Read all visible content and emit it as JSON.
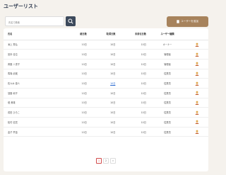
{
  "header": {
    "title": "ユーザーリスト"
  },
  "search": {
    "placeholder": "氏名で検索"
  },
  "toolbar": {
    "add_label": "ユーザーを追加",
    "add_icon": "document-icon",
    "search_icon": "search-icon"
  },
  "table": {
    "columns": {
      "name": "氏名",
      "total": "総日数",
      "used": "取得日数",
      "remaining": "未消化日数",
      "role": "ユーザー種類"
    },
    "rows": [
      {
        "name": "滝上 秀弘",
        "total": "10日",
        "used": "10日",
        "remaining": "10日",
        "role": "オーナー"
      },
      {
        "name": "宮本 佳位",
        "total": "10日",
        "used": "10日",
        "remaining": "10日",
        "role": "管理者"
      },
      {
        "name": "斉藤 八重子",
        "total": "10日",
        "used": "10日",
        "remaining": "10日",
        "role": "管理者"
      },
      {
        "name": "馬場 武蔵",
        "total": "10日",
        "used": "10日",
        "remaining": "10日",
        "role": "従業員"
      },
      {
        "name": "佐々木 源人",
        "total": "10日",
        "used": "10日",
        "remaining": "10日",
        "role": "従業員"
      },
      {
        "name": "須藤 和子",
        "total": "10日",
        "used": "10日",
        "remaining": "10日",
        "role": "従業員"
      },
      {
        "name": "堤 美雄",
        "total": "10日",
        "used": "10日",
        "remaining": "10日",
        "role": "従業員"
      },
      {
        "name": "成田 ひろこ",
        "total": "10日",
        "used": "10日",
        "remaining": "10日",
        "role": "従業員"
      },
      {
        "name": "松村 信寛",
        "total": "10日",
        "used": "10日",
        "remaining": "10日",
        "role": "従業員"
      },
      {
        "name": "金子 早苗",
        "total": "10日",
        "used": "10日",
        "remaining": "10日",
        "role": "従業員"
      }
    ]
  },
  "pagination": {
    "pages": [
      "1",
      "2"
    ],
    "next": "»"
  },
  "colors": {
    "brand": "#a7835c",
    "search_button": "#3d4a5c",
    "active_page": "#d24b4b",
    "link": "#2a6ad0"
  }
}
